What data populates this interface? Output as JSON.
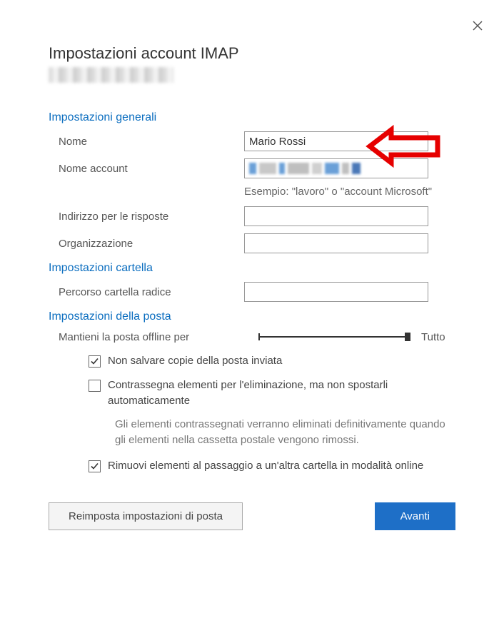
{
  "dialog": {
    "title": "Impostazioni account IMAP"
  },
  "general": {
    "header": "Impostazioni generali",
    "name_label": "Nome",
    "name_value": "Mario Rossi",
    "account_name_label": "Nome account",
    "account_example": "Esempio: \"lavoro\" o \"account Microsoft\"",
    "reply_label": "Indirizzo per le risposte",
    "reply_value": "",
    "org_label": "Organizzazione",
    "org_value": ""
  },
  "folder": {
    "header": "Impostazioni cartella",
    "root_label": "Percorso cartella radice",
    "root_value": ""
  },
  "mail": {
    "header": "Impostazioni della posta",
    "offline_label": "Mantieni la posta offline per",
    "offline_value": "Tutto",
    "cb_dont_save": "Non salvare copie della posta inviata",
    "cb_dont_save_checked": true,
    "cb_mark_delete": "Contrassegna elementi per l'eliminazione, ma non spostarli automaticamente",
    "cb_mark_delete_checked": false,
    "mark_delete_help": "Gli elementi contrassegnati verranno eliminati definitivamente quando gli elementi nella cassetta postale vengono rimossi.",
    "cb_purge": "Rimuovi elementi al passaggio a un'altra cartella in modalità online",
    "cb_purge_checked": true
  },
  "buttons": {
    "reset": "Reimposta impostazioni di posta",
    "next": "Avanti"
  }
}
